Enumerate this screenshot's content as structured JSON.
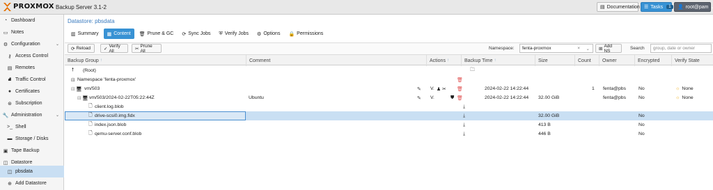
{
  "header": {
    "brand": "PROXMOX",
    "product": "Backup Server 3.1-2",
    "documentation": "Documentation",
    "tasks": "Tasks",
    "tasks_count": "1",
    "user": "root@pam"
  },
  "sidebar": {
    "items": [
      {
        "label": "Dashboard",
        "icon": "gauge-icon"
      },
      {
        "label": "Notes",
        "icon": "note-icon"
      },
      {
        "label": "Configuration",
        "icon": "gears-icon"
      },
      {
        "label": "Access Control",
        "icon": "key-icon"
      },
      {
        "label": "Remotes",
        "icon": "server-icon"
      },
      {
        "label": "Traffic Control",
        "icon": "traffic-icon"
      },
      {
        "label": "Certificates",
        "icon": "certificate-icon"
      },
      {
        "label": "Subscription",
        "icon": "support-icon"
      },
      {
        "label": "Administration",
        "icon": "wrench-icon"
      },
      {
        "label": "Shell",
        "icon": "terminal-icon"
      },
      {
        "label": "Storage / Disks",
        "icon": "hdd-icon"
      },
      {
        "label": "Tape Backup",
        "icon": "tape-icon"
      },
      {
        "label": "Datastore",
        "icon": "database-icon"
      },
      {
        "label": "pbsdata",
        "icon": "database-icon"
      },
      {
        "label": "Add Datastore",
        "icon": "plus-icon"
      }
    ]
  },
  "main": {
    "breadcrumb": "Datastore: pbsdata",
    "tabs": [
      "Summary",
      "Content",
      "Prune & GC",
      "Sync Jobs",
      "Verify Jobs",
      "Options",
      "Permissions"
    ],
    "toolbar": {
      "reload": "Reload",
      "verify_all": "Verify All",
      "prune_all": "Prune All",
      "namespace_label": "Namespace:",
      "namespace_value": "fenta-proxmox",
      "add_ns": "Add NS",
      "search_label": "Search",
      "search_placeholder": "group, date or owner"
    },
    "columns": [
      "Backup Group",
      "Comment",
      "Actions",
      "Backup Time",
      "Size",
      "Count",
      "Owner",
      "Encrypted",
      "Verify State"
    ],
    "rows": [
      {
        "name": "(Root)",
        "comment": "",
        "time": "",
        "size": "",
        "count": "",
        "owner": "",
        "encrypted": "",
        "verify": ""
      },
      {
        "name": "Namespace 'fenta-proxmox'",
        "comment": "",
        "time": "",
        "size": "",
        "count": "",
        "owner": "",
        "encrypted": "",
        "verify": ""
      },
      {
        "name": "vm/503",
        "comment": "",
        "time": "2024-02-22 14:22:44",
        "size": "",
        "count": "1",
        "owner": "fenta@pbs",
        "encrypted": "No",
        "verify": "None"
      },
      {
        "name": "vm/503/2024-02-22T05:22:44Z",
        "comment": "Ubuntu",
        "time": "2024-02-22 14:22:44",
        "size": "32.00 GiB",
        "count": "",
        "owner": "fenta@pbs",
        "encrypted": "No",
        "verify": "None"
      },
      {
        "name": "client.log.blob",
        "comment": "",
        "time": "",
        "size": "",
        "count": "",
        "owner": "",
        "encrypted": "",
        "verify": ""
      },
      {
        "name": "drive-scsi0.img.fidx",
        "comment": "",
        "time": "",
        "size": "32.00 GiB",
        "count": "",
        "owner": "",
        "encrypted": "No",
        "verify": ""
      },
      {
        "name": "index.json.blob",
        "comment": "",
        "time": "",
        "size": "413 B",
        "count": "",
        "owner": "",
        "encrypted": "No",
        "verify": ""
      },
      {
        "name": "qemu-server.conf.blob",
        "comment": "",
        "time": "",
        "size": "446 B",
        "count": "",
        "owner": "",
        "encrypted": "No",
        "verify": ""
      }
    ]
  }
}
